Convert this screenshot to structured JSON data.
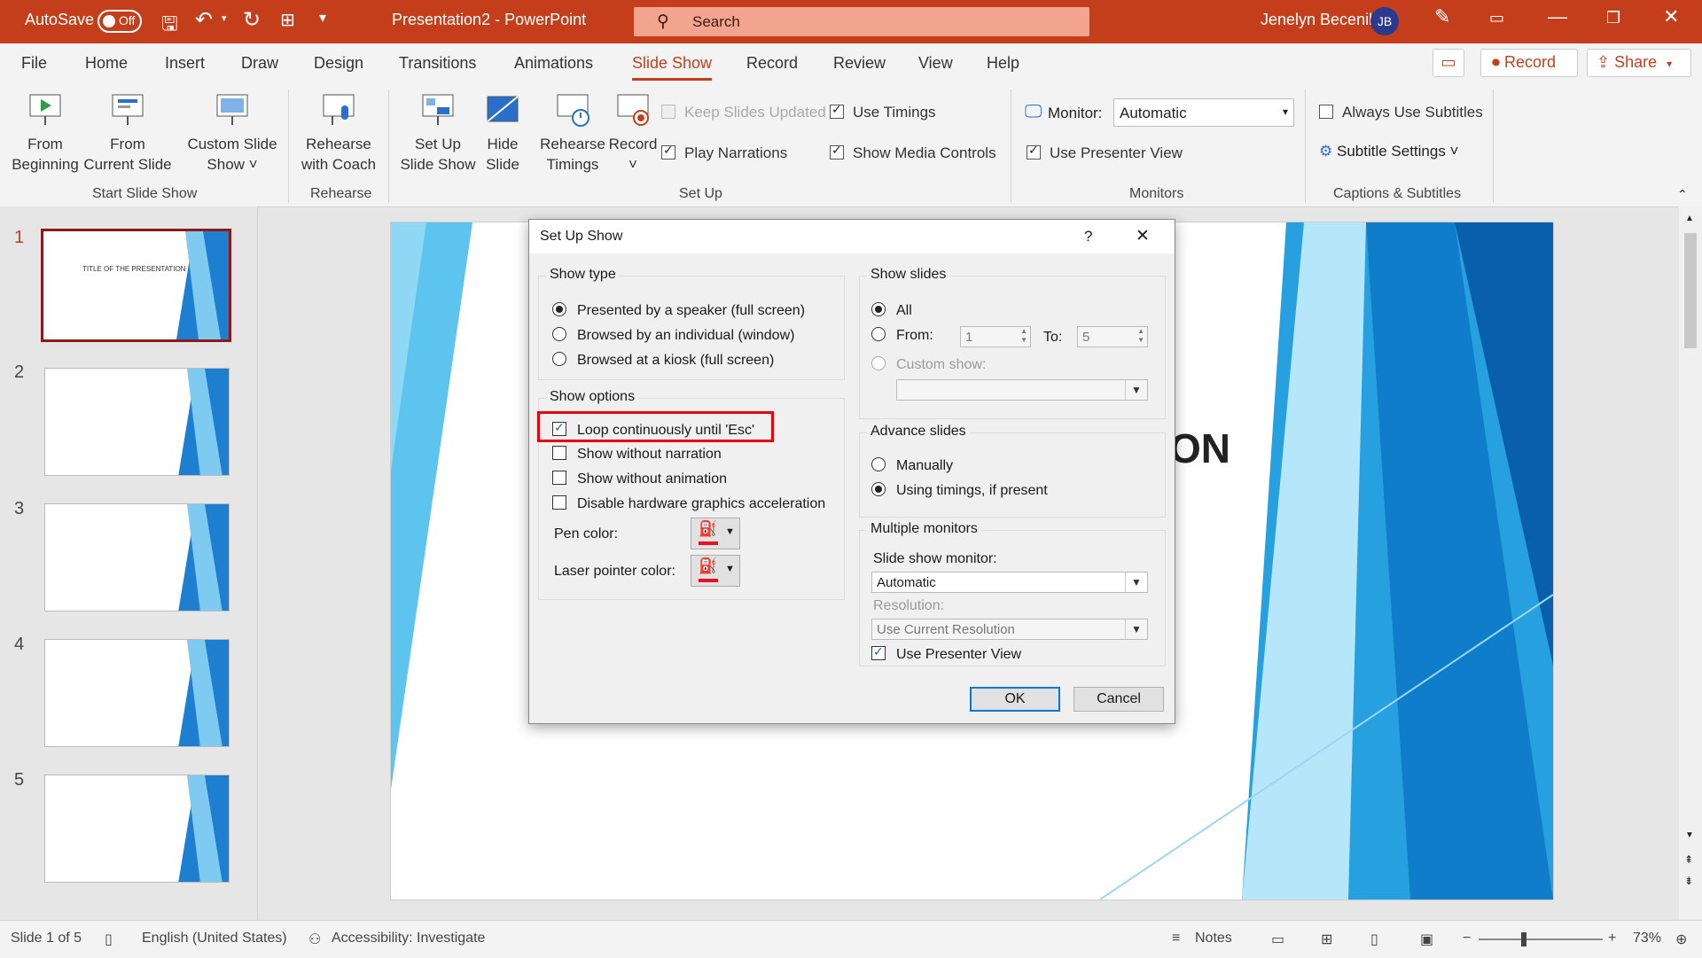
{
  "titlebar": {
    "autosave_label": "AutoSave",
    "autosave_state": "Off",
    "doc_title": "Presentation2  -  PowerPoint",
    "search_placeholder": "Search",
    "user_name": "Jenelyn Becenil",
    "user_initials": "JB"
  },
  "tabs": [
    "File",
    "Home",
    "Insert",
    "Draw",
    "Design",
    "Transitions",
    "Animations",
    "Slide Show",
    "Record",
    "Review",
    "View",
    "Help"
  ],
  "active_tab": "Slide Show",
  "top_buttons": {
    "record": "Record",
    "share": "Share"
  },
  "ribbon": {
    "from_beginning": [
      "From",
      "Beginning"
    ],
    "from_current": [
      "From",
      "Current Slide"
    ],
    "custom_show": [
      "Custom Slide",
      "Show ˅"
    ],
    "group_start": "Start Slide Show",
    "rehearse_coach": [
      "Rehearse",
      "with Coach"
    ],
    "group_rehearse": "Rehearse",
    "setup_show": [
      "Set Up",
      "Slide Show"
    ],
    "hide_slide": [
      "Hide",
      "Slide"
    ],
    "rehearse_timings": [
      "Rehearse",
      "Timings"
    ],
    "record": [
      "Record",
      "˅"
    ],
    "keep_slides_updated": "Keep Slides Updated",
    "play_narrations": "Play Narrations",
    "use_timings": "Use Timings",
    "show_media_controls": "Show Media Controls",
    "group_setup": "Set Up",
    "monitor_label": "Monitor:",
    "monitor_value": "Automatic",
    "use_presenter_view": "Use Presenter View",
    "group_monitors": "Monitors",
    "always_subtitles": "Always Use Subtitles",
    "subtitle_settings": "Subtitle Settings ˅",
    "group_captions": "Captions & Subtitles"
  },
  "slides": {
    "numbers": [
      "1",
      "2",
      "3",
      "4",
      "5"
    ],
    "thumb1_title": "TITLE OF THE PRESENTATION"
  },
  "slide_title_fragment": "ON",
  "dialog": {
    "title": "Set Up Show",
    "help": "?",
    "close": "✕",
    "show_type_legend": "Show type",
    "show_type_options": [
      "Presented by a speaker (full screen)",
      "Browsed by an individual (window)",
      "Browsed at a kiosk (full screen)"
    ],
    "show_options_legend": "Show options",
    "show_options": [
      "Loop continuously until 'Esc'",
      "Show without narration",
      "Show without animation",
      "Disable hardware graphics acceleration"
    ],
    "pen_color_label": "Pen color:",
    "laser_color_label": "Laser pointer color:",
    "pen_color": "#e81123",
    "show_slides_legend": "Show slides",
    "all_label": "All",
    "from_label": "From:",
    "from_value": "1",
    "to_label": "To:",
    "to_value": "5",
    "custom_show_label": "Custom show:",
    "advance_legend": "Advance slides",
    "advance_options": [
      "Manually",
      "Using timings, if present"
    ],
    "multi_legend": "Multiple monitors",
    "slide_show_monitor_label": "Slide show monitor:",
    "slide_show_monitor_value": "Automatic",
    "resolution_label": "Resolution:",
    "resolution_value": "Use Current Resolution",
    "use_presenter_view": "Use Presenter View",
    "ok": "OK",
    "cancel": "Cancel"
  },
  "status": {
    "slide_info": "Slide 1 of 5",
    "language": "English (United States)",
    "accessibility": "Accessibility: Investigate",
    "notes": "Notes",
    "zoom": "73%"
  },
  "colors": {
    "accent": "#c43e1c",
    "highlight": "#e8000b",
    "slide_blue": "#1e90d6"
  }
}
